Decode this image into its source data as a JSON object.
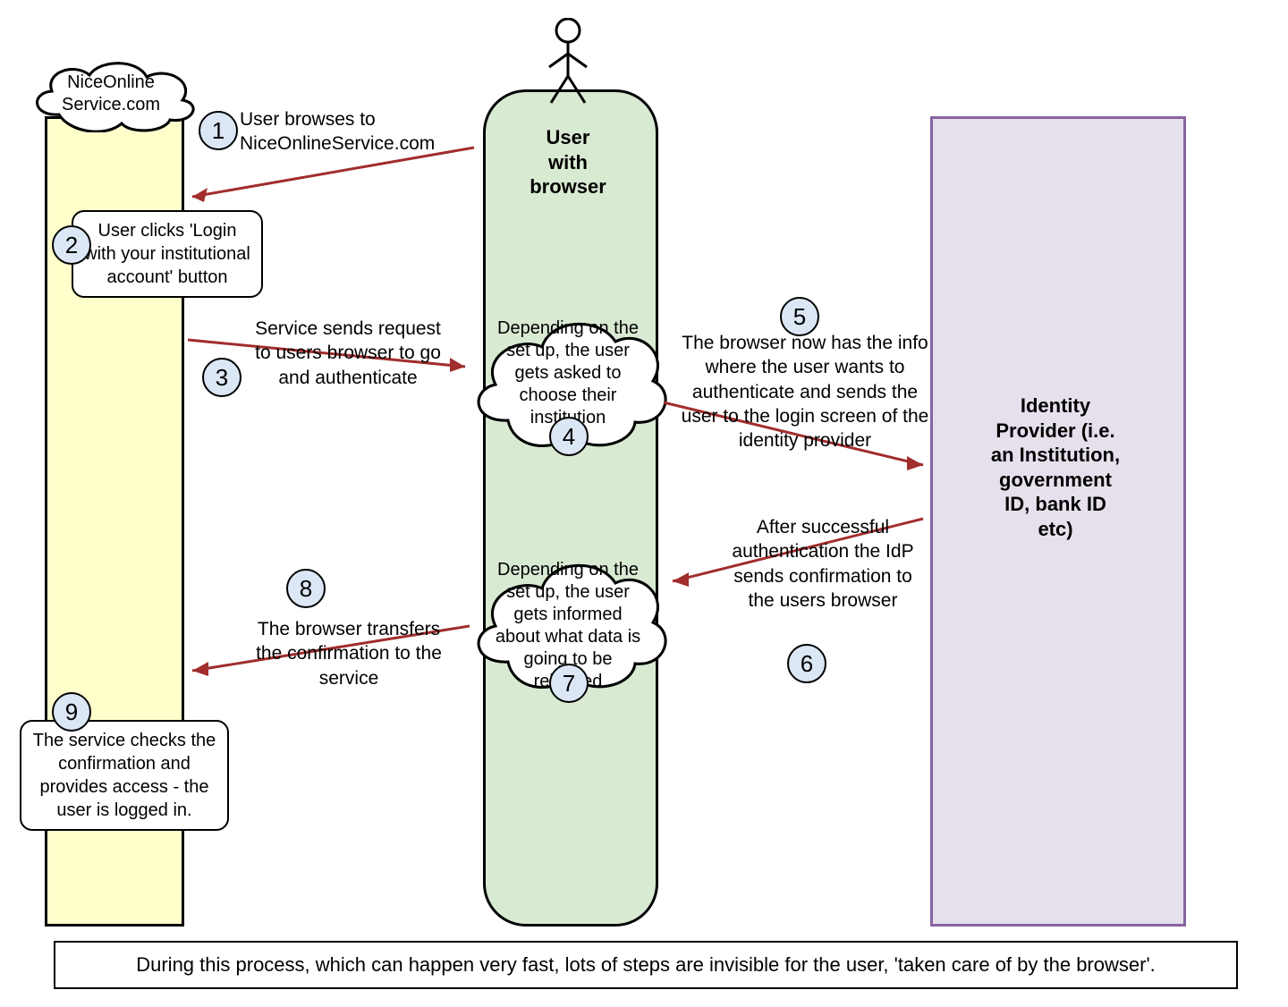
{
  "lanes": {
    "service_cloud": "NiceOnline\nService.com",
    "user": "User\nwith\nbrowser",
    "idp": "Identity\nProvider (i.e.\nan Institution,\ngovernment\nID, bank ID\netc)"
  },
  "steps": {
    "1": "User browses to NiceOnlineService.com",
    "2": "User clicks 'Login with your institutional account' button",
    "3": "Service sends request to users browser to go and authenticate",
    "4": "Depending on the set up, the user gets asked to choose their institution",
    "5": "The browser now has the info where the user wants to authenticate and sends the user to the login screen of the identity provider",
    "6": "After successful authentication the IdP sends confirmation to the users browser",
    "7": "Depending on the set up, the user gets informed about what data is going to be released",
    "8": "The browser transfers the confirmation to the service",
    "9": "The service checks the confirmation and provides access - the user is logged in."
  },
  "num_labels": {
    "1": "1",
    "2": "2",
    "3": "3",
    "4": "4",
    "5": "5",
    "6": "6",
    "7": "7",
    "8": "8",
    "9": "9"
  },
  "footer": "During this process, which can happen very fast, lots of steps are invisible for the user, 'taken care of by the browser'."
}
